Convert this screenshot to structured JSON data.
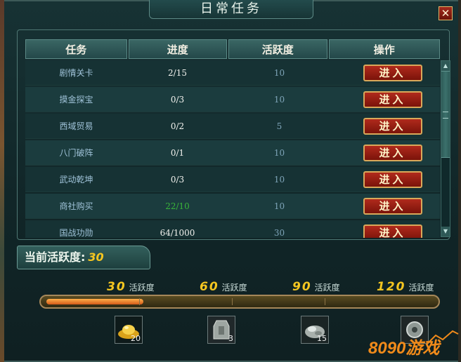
{
  "window": {
    "title": "日常任务",
    "close_label": "✕"
  },
  "table": {
    "headers": [
      "任务",
      "进度",
      "活跃度",
      "操作"
    ],
    "rows": [
      {
        "task": "剧情关卡",
        "progress": "2/15",
        "progress_complete": false,
        "activity": "10",
        "action": "进入"
      },
      {
        "task": "摸金探宝",
        "progress": "0/3",
        "progress_complete": false,
        "activity": "10",
        "action": "进入"
      },
      {
        "task": "西域贸易",
        "progress": "0/2",
        "progress_complete": false,
        "activity": "5",
        "action": "进入"
      },
      {
        "task": "八门破阵",
        "progress": "0/1",
        "progress_complete": false,
        "activity": "10",
        "action": "进入"
      },
      {
        "task": "武动乾坤",
        "progress": "0/3",
        "progress_complete": false,
        "activity": "10",
        "action": "进入"
      },
      {
        "task": "商社购买",
        "progress": "22/10",
        "progress_complete": true,
        "activity": "10",
        "action": "进入"
      },
      {
        "task": "国战功勋",
        "progress": "64/1000",
        "progress_complete": false,
        "activity": "30",
        "action": "进入"
      }
    ]
  },
  "scrollbar": {
    "up_icon": "▲",
    "down_icon": "▼"
  },
  "activity": {
    "label": "当前活跃度:",
    "value": "30",
    "progress_fraction": 0.25,
    "milestones": [
      {
        "value": "30",
        "unit": "活跃度"
      },
      {
        "value": "60",
        "unit": "活跃度"
      },
      {
        "value": "90",
        "unit": "活跃度"
      },
      {
        "value": "120",
        "unit": "活跃度"
      }
    ]
  },
  "rewards": [
    {
      "icon": "gold-ingot-icon",
      "count": "20"
    },
    {
      "icon": "token-tablet-icon",
      "count": "3"
    },
    {
      "icon": "silver-ore-icon",
      "count": "15"
    },
    {
      "icon": "gear-box-icon",
      "count": ""
    }
  ],
  "watermark": {
    "text": "8090游戏"
  },
  "colors": {
    "accent_gold": "#f5c620",
    "button_red": "#b02a1c",
    "completed_green": "#39b43a"
  }
}
